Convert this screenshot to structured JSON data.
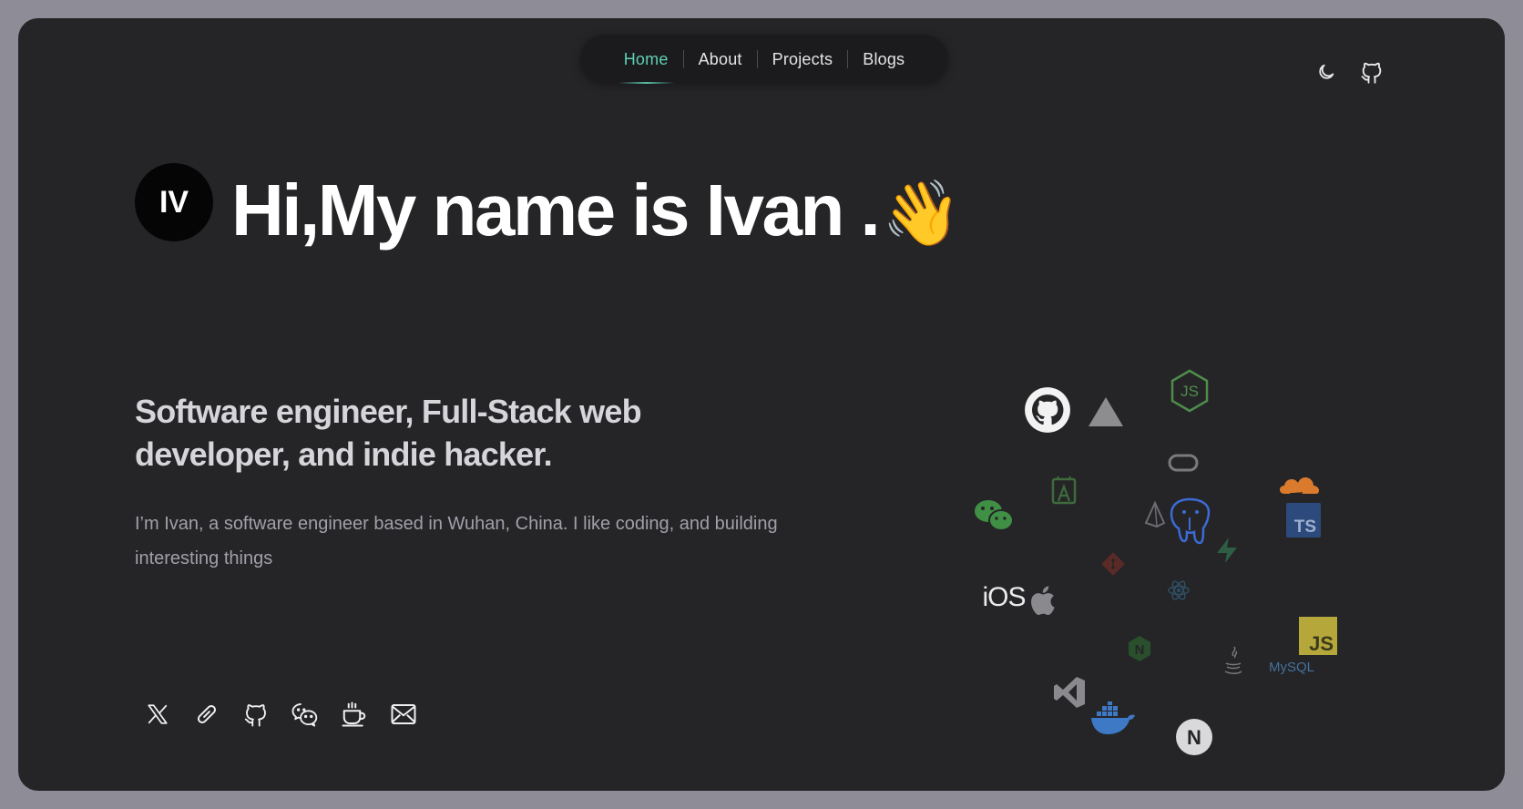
{
  "nav": {
    "items": [
      {
        "label": "Home",
        "active": true
      },
      {
        "label": "About",
        "active": false
      },
      {
        "label": "Projects",
        "active": false
      },
      {
        "label": "Blogs",
        "active": false
      }
    ]
  },
  "header_icons": [
    "moon-icon",
    "github-icon"
  ],
  "hero": {
    "avatar_initials": "IV",
    "title": "Hi,My name is Ivan .",
    "wave_emoji": "👋",
    "subtitle": "Software engineer, Full-Stack web developer, and indie hacker.",
    "description": "I’m Ivan, a software engineer based in Wuhan, China. I like coding, and building interesting things"
  },
  "social_icons": [
    "x-icon",
    "link-icon",
    "github-icon",
    "wechat-icon",
    "coffee-icon",
    "mail-icon"
  ],
  "tech_cloud": {
    "ios_label": "iOS",
    "ts_label": "TS",
    "js_label": "JS",
    "mysql_label": "MySQL",
    "nuxt_label": "N",
    "next_label": "N",
    "icons": [
      "github-icon",
      "vercel-icon",
      "nodejs-icon",
      "oracle-icon",
      "cloudflare-icon",
      "android-studio-icon",
      "wechat-icon",
      "prisma-icon",
      "postgresql-icon",
      "typescript-icon",
      "supabase-icon",
      "git-icon",
      "react-icon",
      "apple-icon",
      "javascript-icon",
      "nginx-icon",
      "java-icon",
      "mysql-icon",
      "vscode-icon",
      "docker-icon",
      "nextjs-icon"
    ]
  },
  "colors": {
    "background": "#252528",
    "accent": "#5fd0b2",
    "frame": "#8e8c96"
  }
}
